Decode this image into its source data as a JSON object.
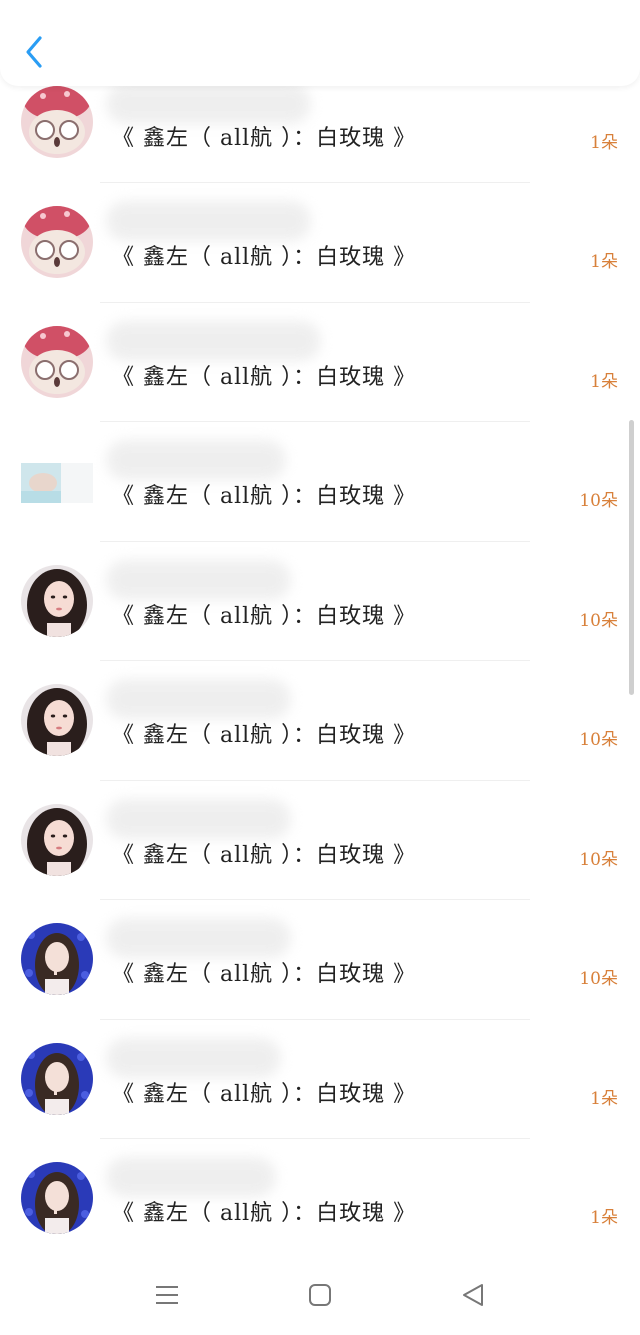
{
  "header": {
    "back_icon": "chevron-left-icon",
    "accent_color": "#2a9df4"
  },
  "rows": [
    {
      "content": "《 鑫左（ all航 ）：白玫瑰 》",
      "count": "1朵",
      "avatar": "pink-hat-avatar"
    },
    {
      "content": "《 鑫左（ all航 ）：白玫瑰 》",
      "count": "1朵",
      "avatar": "pink-hat-avatar"
    },
    {
      "content": "《 鑫左（ all航 ）：白玫瑰 》",
      "count": "1朵",
      "avatar": "pink-hat-avatar"
    },
    {
      "content": "《 鑫左（ all航 ）：白玫瑰 》",
      "count": "10朵",
      "avatar": "light-blue-photo-avatar"
    },
    {
      "content": "《 鑫左（ all航 ）：白玫瑰 》",
      "count": "10朵",
      "avatar": "girl-portrait-avatar"
    },
    {
      "content": "《 鑫左（ all航 ）：白玫瑰 》",
      "count": "10朵",
      "avatar": "girl-portrait-avatar"
    },
    {
      "content": "《 鑫左（ all航 ）：白玫瑰 》",
      "count": "10朵",
      "avatar": "girl-portrait-avatar"
    },
    {
      "content": "《 鑫左（ all航 ）：白玫瑰 》",
      "count": "10朵",
      "avatar": "blue-bg-girl-avatar"
    },
    {
      "content": "《 鑫左（ all航 ）：白玫瑰 》",
      "count": "1朵",
      "avatar": "blue-bg-girl-avatar"
    },
    {
      "content": "《 鑫左（ all航 ）：白玫瑰 》",
      "count": "1朵",
      "avatar": "blue-bg-girl-avatar"
    }
  ],
  "navbar": {
    "menu_icon": "menu-icon",
    "home_icon": "home-square-icon",
    "back_icon": "back-triangle-icon"
  },
  "colors": {
    "count": "#d8803a",
    "text": "#222222",
    "divider": "#efefef"
  }
}
